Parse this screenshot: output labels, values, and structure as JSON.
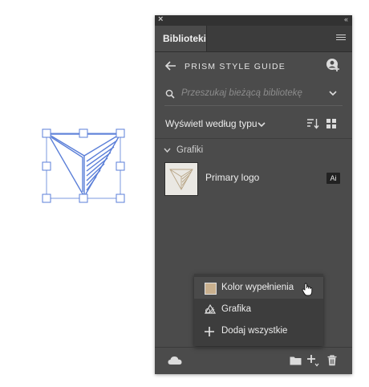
{
  "panel": {
    "close_glyph": "×",
    "collapse_glyph": "‹‹",
    "tab_label": "Biblioteki",
    "menu_icon": "hamburger-menu-icon"
  },
  "library": {
    "name": "PRISM STYLE GUIDE",
    "back_icon": "arrow-left-icon",
    "collaborate_icon": "add-user-icon"
  },
  "search": {
    "placeholder": "Przeszukaj bieżącą bibliotekę",
    "icon": "search-icon"
  },
  "view": {
    "label": "Wyświetl według typu",
    "sort_icon": "sort-icon",
    "grid_icon": "grid-view-icon"
  },
  "section": {
    "label": "Grafiki"
  },
  "asset": {
    "name": "Primary logo",
    "badge": "Ai"
  },
  "popup": {
    "items": [
      {
        "label": "Kolor wypełnienia",
        "icon": "color-swatch-icon",
        "swatch": "#c9b08e"
      },
      {
        "label": "Grafika",
        "icon": "graphic-icon"
      },
      {
        "label": "Dodaj wszystkie",
        "icon": "plus-icon"
      }
    ]
  },
  "colors": {
    "panel_bg": "#4b4b4b",
    "selection_blue": "#5a7fd6",
    "fill_swatch": "#c9b08e"
  }
}
